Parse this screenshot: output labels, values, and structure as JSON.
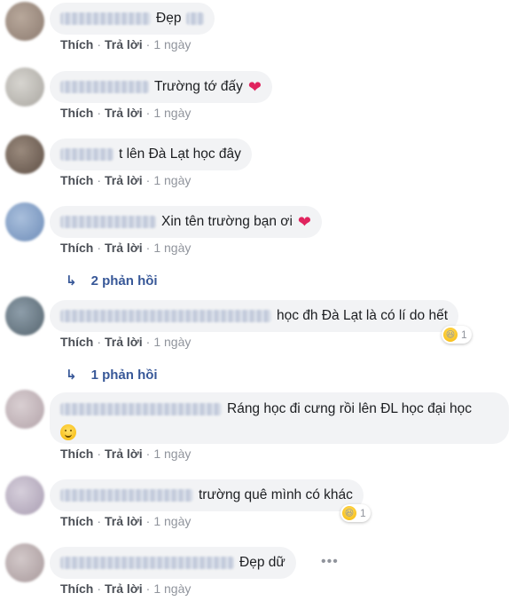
{
  "actions": {
    "like": "Thích",
    "reply": "Trả lời",
    "separator": "·",
    "time": "1 ngày"
  },
  "comments": [
    {
      "text": "Đẹp",
      "reaction_icon": "none"
    },
    {
      "text": "Trường tớ đấy",
      "reaction_icon": "heart-icon"
    },
    {
      "text": "t lên Đà Lạt học đây"
    },
    {
      "text": "Xin tên trường bạn ơi",
      "reaction_icon": "heart-icon",
      "replies_label": "2 phản hồi"
    },
    {
      "text": "học đh Đà Lạt là có lí do hết",
      "reaction_count": "1",
      "reaction_icon": "laugh-emoji-icon",
      "replies_label": "1 phản hồi"
    },
    {
      "text": "Ráng học đi cưng rồi lên ĐL học đại học",
      "trailing_icon": "smile-emoji-icon"
    },
    {
      "text": "trường quê mình có khác",
      "reaction_count": "1",
      "reaction_icon": "laugh-emoji-icon"
    },
    {
      "text": "Đẹp dữ",
      "more_icon": "more-options-icon"
    }
  ],
  "colors": {
    "link_blue": "#385898",
    "action_gray": "#4b4f56",
    "bubble_bg": "#f2f3f5",
    "heart_red": "#e0245e"
  }
}
